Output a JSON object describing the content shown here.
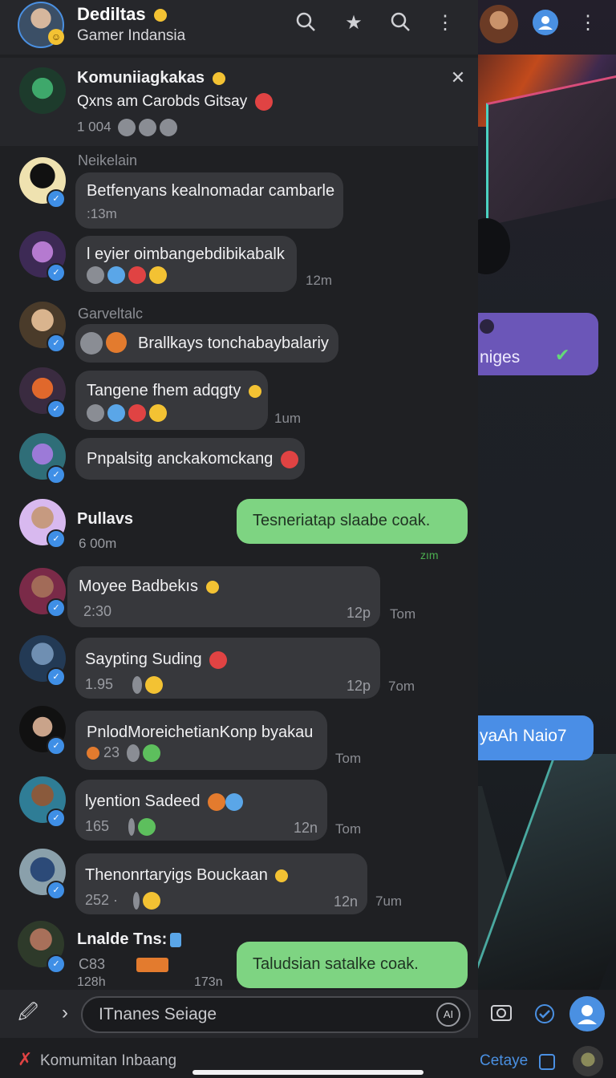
{
  "header": {
    "title": "Dediltas",
    "subtitle": "Gamer Indansia"
  },
  "pinned": {
    "title": "Komuniiagkakas",
    "text": "Qxns am Carobds Gitsay",
    "count": "1 004"
  },
  "messages": [
    {
      "sender": "Neikelain",
      "text": "Betfenyans kealnomadar cambarle",
      "time": ":13m"
    },
    {
      "sender": "",
      "text": "l eyier oimbangebdibikabalk",
      "time": "12m"
    },
    {
      "sender": "Garveltalc",
      "text": "Brallkays tonchabaybalariy",
      "time": ""
    },
    {
      "sender": "",
      "text": "Tangene fhem adqgty",
      "time": "1um"
    },
    {
      "sender": "",
      "text": "Pnpalsitg anckakomckang",
      "time": ""
    }
  ],
  "chat_preview": {
    "title": "Pullavs",
    "time": "6 00m"
  },
  "green_msgs": [
    {
      "text": "Tesneriatap slaabe coak.",
      "time": "zım"
    },
    {
      "text": "Taludsian satalke coak.",
      "time": ""
    }
  ],
  "rows": [
    {
      "title": "Moyee Badbekıs",
      "sub": "2:30",
      "time": "12p",
      "outer": "Tom"
    },
    {
      "title": "Saypting Suding",
      "sub": "1.95",
      "time": "12p",
      "outer": "7om"
    },
    {
      "title": "PnlodMoreichetianKonp byakau",
      "sub": "23",
      "time": "",
      "outer": "Tom"
    },
    {
      "title": "lyention Sadeed",
      "sub": "165",
      "time": "12n",
      "outer": "Tom"
    },
    {
      "title": "Thenonrtaryigs Bouckaan",
      "sub": "252 ·",
      "time": "12n",
      "outer": "7um"
    },
    {
      "title": "Lnalde Tns:",
      "sub": "C83",
      "sub2": "128h",
      "time": "173n",
      "outer": ""
    }
  ],
  "right_panel": {
    "purple_text": "niges",
    "blue_text": "yaAh Naio7"
  },
  "composer": {
    "placeholder": "ITnanes Seiage"
  },
  "bottom": {
    "left_label": "Komumitan Inbaang",
    "right_label": "Cetaye"
  },
  "icons": [
    "search-icon",
    "star-icon",
    "search-icon",
    "more-icon",
    "close-icon",
    "attach-icon",
    "send-icon",
    "camera-icon",
    "check-icon",
    "profile-icon"
  ],
  "colors": {
    "accent": "#4a90e2",
    "green_bubble": "#7ed482",
    "purple_bubble": "#6b56b8",
    "blue_bubble": "#4a8ee6"
  }
}
